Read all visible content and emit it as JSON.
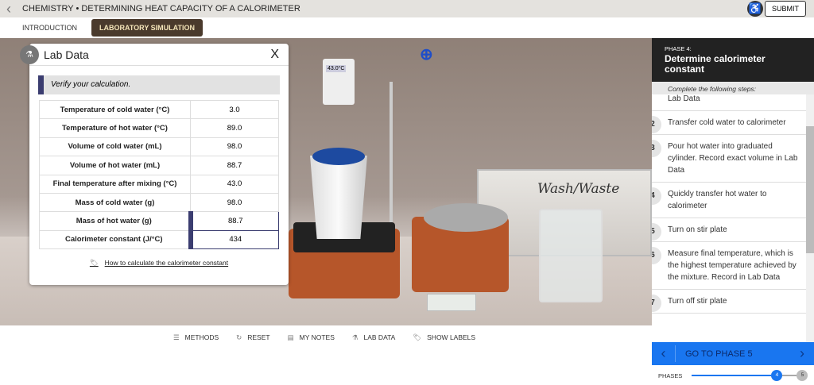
{
  "header": {
    "title": "CHEMISTRY • DETERMINING HEAT CAPACITY OF A CALORIMETER",
    "submit": "SUBMIT"
  },
  "tabs": [
    {
      "label": "INTRODUCTION"
    },
    {
      "label": "LABORATORY SIMULATION"
    }
  ],
  "scene": {
    "thermometer_reading": "43.0°C",
    "sink_label": "Wash/Waste"
  },
  "lab_data": {
    "title": "Lab Data",
    "close": "X",
    "notice": "Verify your calculation.",
    "rows": [
      {
        "label": "Temperature of cold water (°C)",
        "value": "3.0"
      },
      {
        "label": "Temperature of hot water (°C)",
        "value": "89.0"
      },
      {
        "label": "Volume of cold water (mL)",
        "value": "98.0"
      },
      {
        "label": "Volume of hot water (mL)",
        "value": "88.7"
      },
      {
        "label": "Final temperature after mixing (°C)",
        "value": "43.0"
      },
      {
        "label": "Mass of cold water (g)",
        "value": "98.0"
      },
      {
        "label": "Mass of hot water (g)",
        "value": "88.7"
      },
      {
        "label": "Calorimeter constant (J/°C)",
        "value": "434"
      }
    ],
    "help_link": "How to calculate the calorimeter constant"
  },
  "toolbar": {
    "methods": "METHODS",
    "reset": "RESET",
    "notes": "MY NOTES",
    "lab_data": "LAB DATA",
    "labels": "SHOW LABELS"
  },
  "phase": {
    "label": "PHASE 4:",
    "title": "Determine calorimeter constant",
    "steps_label": "Complete the following steps:",
    "steps": [
      {
        "num": "",
        "text": "Lab Data"
      },
      {
        "num": "2",
        "text": "Transfer cold water to calorimeter"
      },
      {
        "num": "3",
        "text": "Pour hot water into graduated cylinder. Record exact volume in Lab Data"
      },
      {
        "num": "4",
        "text": "Quickly transfer hot water to calorimeter"
      },
      {
        "num": "5",
        "text": "Turn on stir plate"
      },
      {
        "num": "6",
        "text": "Measure final temperature, which is the highest temperature achieved by the mixture. Record in Lab Data"
      },
      {
        "num": "7",
        "text": "Turn off stir plate"
      }
    ],
    "next": "GO TO PHASE 5",
    "phases_label": "PHASES",
    "current": "4",
    "last": "5"
  }
}
